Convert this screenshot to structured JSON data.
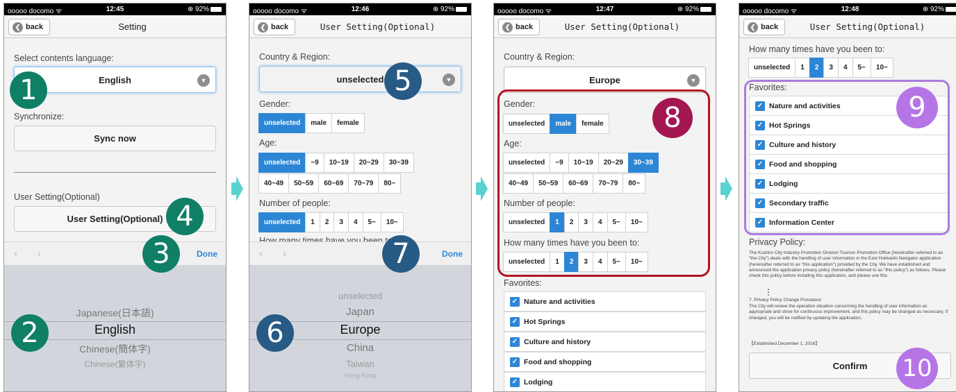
{
  "status_bars": [
    {
      "carrier": "ooooo docomo ᯤ",
      "time": "12:45",
      "battery": "⊕ 92%"
    },
    {
      "carrier": "ooooo docomo ᯤ",
      "time": "12:46",
      "battery": "⊕ 92%"
    },
    {
      "carrier": "ooooo docomo ᯤ",
      "time": "12:47",
      "battery": "⊕ 92%"
    },
    {
      "carrier": "ooooo docomo ᯤ",
      "time": "12:48",
      "battery": "⊕ 92%"
    }
  ],
  "back_label": "back",
  "colors": {
    "accent": "#2d86d5",
    "step_green": "#0f7f65",
    "step_blue": "#285a86",
    "step_magenta": "#a3164f",
    "step_purple": "#b675e6",
    "arrow": "#5ad3d0"
  },
  "screen1": {
    "title": "Setting",
    "language_label": "Select contents language:",
    "language_value": "English",
    "sync_label": "Synchronize:",
    "sync_button": "Sync now",
    "user_setting_label": "User Setting(Optional)",
    "user_setting_button": "User Setting(Optional)",
    "done": "Done",
    "picker": [
      "Japanese(日本語)",
      "English",
      "Chinese(簡体字)",
      "Chinese(繁体字)"
    ],
    "steps": [
      "1",
      "2",
      "3",
      "4"
    ]
  },
  "screen2": {
    "title": "User Setting(Optional)",
    "country_label": "Country & Region:",
    "country_value": "unselected",
    "gender_label": "Gender:",
    "gender": [
      "unselected",
      "male",
      "female"
    ],
    "age_label": "Age:",
    "age_row1": [
      "unselected",
      "~9",
      "10~19",
      "20~29",
      "30~39"
    ],
    "age_row2": [
      "40~49",
      "50~59",
      "60~69",
      "70~79",
      "80~"
    ],
    "people_label": "Number of people:",
    "people": [
      "unselected",
      "1",
      "2",
      "3",
      "4",
      "5~",
      "10~"
    ],
    "hidden_label": "How many times have you been to:",
    "done": "Done",
    "picker": [
      "unselected",
      "Japan",
      "Europe",
      "China",
      "Taiwan",
      "Hong Kong"
    ],
    "steps": [
      "5",
      "6",
      "7"
    ]
  },
  "screen3": {
    "title": "User Setting(Optional)",
    "country_label": "Country & Region:",
    "country_value": "Europe",
    "gender_label": "Gender:",
    "gender": [
      "unselected",
      "male",
      "female"
    ],
    "age_label": "Age:",
    "age_row1": [
      "unselected",
      "~9",
      "10~19",
      "20~29",
      "30~39"
    ],
    "age_row2": [
      "40~49",
      "50~59",
      "60~69",
      "70~79",
      "80~"
    ],
    "people_label": "Number of people:",
    "people": [
      "unselected",
      "1",
      "2",
      "3",
      "4",
      "5~",
      "10~"
    ],
    "visits_label": "How many times have you been to:",
    "visits": [
      "unselected",
      "1",
      "2",
      "3",
      "4",
      "5~",
      "10~"
    ],
    "favorites_label": "Favorites:",
    "favorites": [
      "Nature and activities",
      "Hot Springs",
      "Culture and history",
      "Food and shopping",
      "Lodging"
    ],
    "steps": [
      "8"
    ]
  },
  "screen4": {
    "title": "User Setting(Optional)",
    "visits_label": "How many times have you been to:",
    "visits": [
      "unselected",
      "1",
      "2",
      "3",
      "4",
      "5~",
      "10~"
    ],
    "favorites_label": "Favorites:",
    "favorites": [
      "Nature and activities",
      "Hot Springs",
      "Culture and history",
      "Food and shopping",
      "Lodging",
      "Secondary traffic",
      "Information Center"
    ],
    "privacy_label": "Privacy Policy:",
    "privacy_text": "The Kushiro City Industry Promotion Division Tourism Promotion Office (hereinafter referred to as \"the City\") deals with the handling of user information in the East Hokkaido Navigator application (hereinafter referred to as \"this application\") provided by the City. We have established and announced the application privacy policy (hereinafter referred to as \"this policy\") as follows. Please check this policy before installing this application, and please use this",
    "ellipsis": "⋮",
    "change_title": "7. Privacy Policy Change Procedure",
    "change_text": "The City will review the operation situation concerning the handling of user information as appropriate and strive for continuous improvement, and this policy may be changed as necessary. If changed, you will be notified by updating the application.",
    "established": "【Established December 1, 2016】",
    "confirm": "Confirm",
    "steps": [
      "9",
      "10"
    ]
  }
}
